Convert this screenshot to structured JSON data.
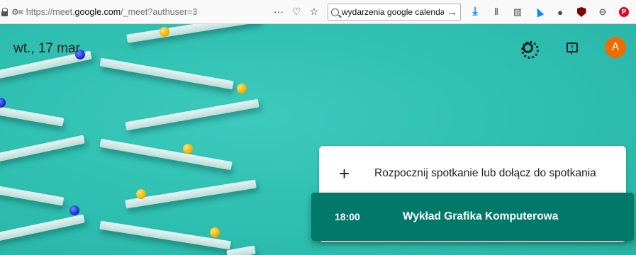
{
  "browser": {
    "url_prefix": "https://meet.",
    "url_domain": "google.com",
    "url_suffix": "/_meet?authuser=3",
    "search_query": "wydarzenia google calenda",
    "search_go_icon": "arrow-right-icon"
  },
  "meet": {
    "date": "wt., 17 mar",
    "avatar_letter": "A",
    "start_label": "Rozpocznij spotkanie lub dołącz do spotkania",
    "meeting": {
      "time": "18:00",
      "title": "Wykład Grafika Komputerowa"
    }
  },
  "colors": {
    "background": "#2ebfb0",
    "meeting_card": "#00796b",
    "avatar": "#ef6c00"
  }
}
